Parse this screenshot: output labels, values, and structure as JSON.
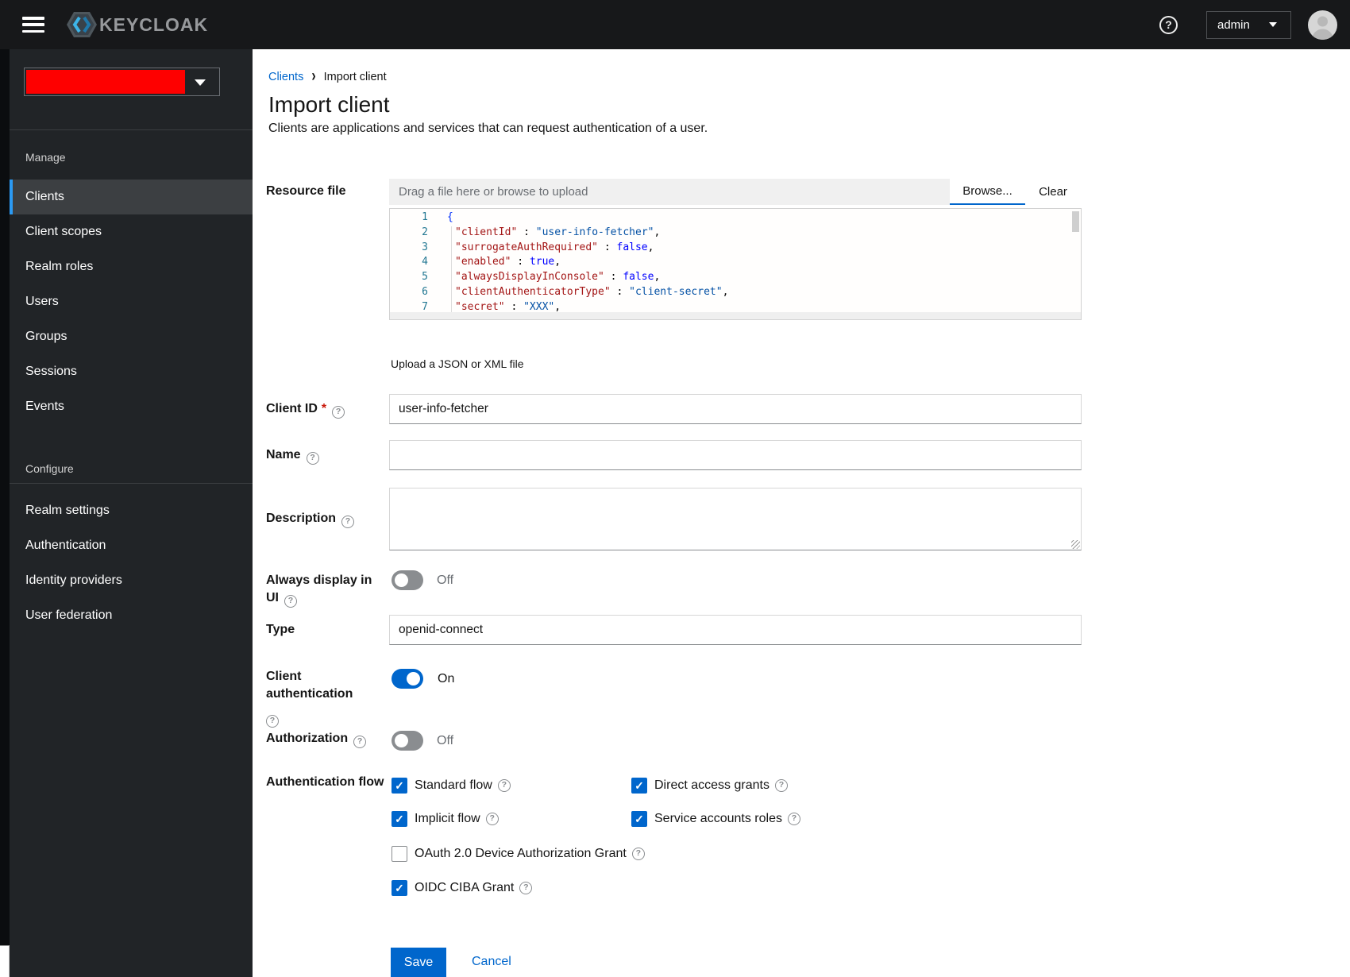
{
  "masthead": {
    "brand": "KEYCLOAK",
    "user": "admin"
  },
  "sidebar": {
    "manage": {
      "title": "Manage",
      "items": [
        "Clients",
        "Client scopes",
        "Realm roles",
        "Users",
        "Groups",
        "Sessions",
        "Events"
      ]
    },
    "configure": {
      "title": "Configure",
      "items": [
        "Realm settings",
        "Authentication",
        "Identity providers",
        "User federation"
      ]
    },
    "active_item": "Clients"
  },
  "breadcrumb": {
    "parent": "Clients",
    "current": "Import client"
  },
  "page": {
    "title": "Import client",
    "subtitle": "Clients are applications and services that can request authentication of a user."
  },
  "form": {
    "resource_file": {
      "label": "Resource file",
      "placeholder": "Drag a file here or browse to upload",
      "browse": "Browse...",
      "clear": "Clear",
      "helper": "Upload a JSON or XML file"
    },
    "code": {
      "line_numbers": [
        "1",
        "2",
        "3",
        "4",
        "5",
        "6",
        "7"
      ],
      "sep": " : ",
      "comma": ",",
      "l1": "{",
      "l2k": "\"clientId\"",
      "l2v": "\"user-info-fetcher\"",
      "l3k": "\"surrogateAuthRequired\"",
      "l3v": "false",
      "l4k": "\"enabled\"",
      "l4v": "true",
      "l5k": "\"alwaysDisplayInConsole\"",
      "l5v": "false",
      "l6k": "\"clientAuthenticatorType\"",
      "l6v": "\"client-secret\"",
      "l7k": "\"secret\"",
      "l7v": "\"XXX\""
    },
    "client_id": {
      "label": "Client ID",
      "value": "user-info-fetcher",
      "required": true
    },
    "name": {
      "label": "Name",
      "value": ""
    },
    "description": {
      "label": "Description",
      "value": ""
    },
    "always_display": {
      "label": "Always display in UI",
      "state": "Off",
      "on": false
    },
    "type": {
      "label": "Type",
      "value": "openid-connect"
    },
    "client_auth": {
      "label": "Client authentication",
      "state": "On",
      "on": true
    },
    "authorization": {
      "label": "Authorization",
      "state": "Off",
      "on": false
    },
    "auth_flow": {
      "label": "Authentication flow",
      "items": [
        {
          "label": "Standard flow",
          "checked": true
        },
        {
          "label": "Direct access grants",
          "checked": true
        },
        {
          "label": "Implicit flow",
          "checked": true
        },
        {
          "label": "Service accounts roles",
          "checked": true
        },
        {
          "label": "OAuth 2.0 Device Authorization Grant",
          "checked": false
        },
        {
          "label": "OIDC CIBA Grant",
          "checked": true
        }
      ]
    },
    "actions": {
      "save": "Save",
      "cancel": "Cancel"
    }
  },
  "colors": {
    "primary": "#0066cc",
    "nav_indicator": "#2b9af3",
    "redaction": "#fe0000",
    "code_key": "#a31515",
    "code_string": "#0451a5",
    "code_keyword": "#0000ff"
  }
}
